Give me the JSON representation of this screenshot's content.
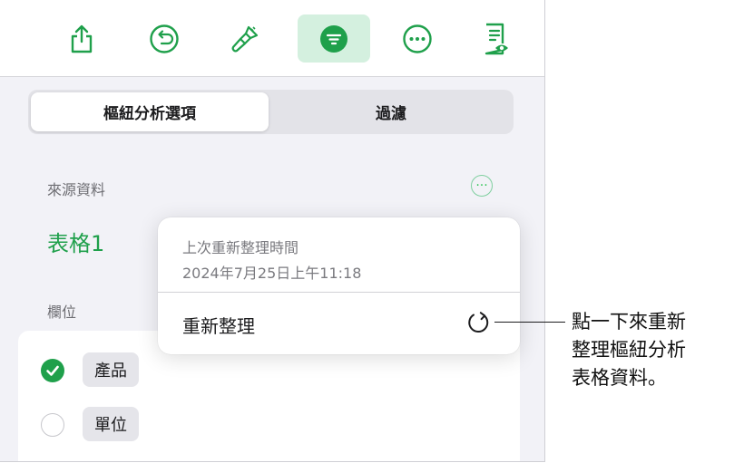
{
  "toolbar": {
    "buttons": [
      {
        "name": "share",
        "icon": "share-icon"
      },
      {
        "name": "undo",
        "icon": "undo-icon"
      },
      {
        "name": "format",
        "icon": "paintbrush-icon"
      },
      {
        "name": "organize",
        "icon": "filter-icon",
        "active": true
      },
      {
        "name": "more",
        "icon": "ellipsis-icon"
      },
      {
        "name": "view",
        "icon": "document-view-icon"
      }
    ],
    "accent": "#1fa04b",
    "active_bg": "#d4f0df"
  },
  "tabs": {
    "pivot_options": "樞紐分析選項",
    "filter": "過濾"
  },
  "source": {
    "label": "來源資料",
    "name": "表格1"
  },
  "fields": {
    "label": "欄位",
    "items": [
      {
        "label": "產品",
        "checked": true
      },
      {
        "label": "單位",
        "checked": false
      }
    ]
  },
  "popover": {
    "last_refresh_label": "上次重新整理時間",
    "last_refresh_time": "2024年7月25日上午11:18",
    "action": "重新整理",
    "action_icon": "refresh-icon"
  },
  "callout": {
    "lines": [
      "點一下來重新",
      "整理樞紐分析",
      "表格資料。"
    ]
  }
}
